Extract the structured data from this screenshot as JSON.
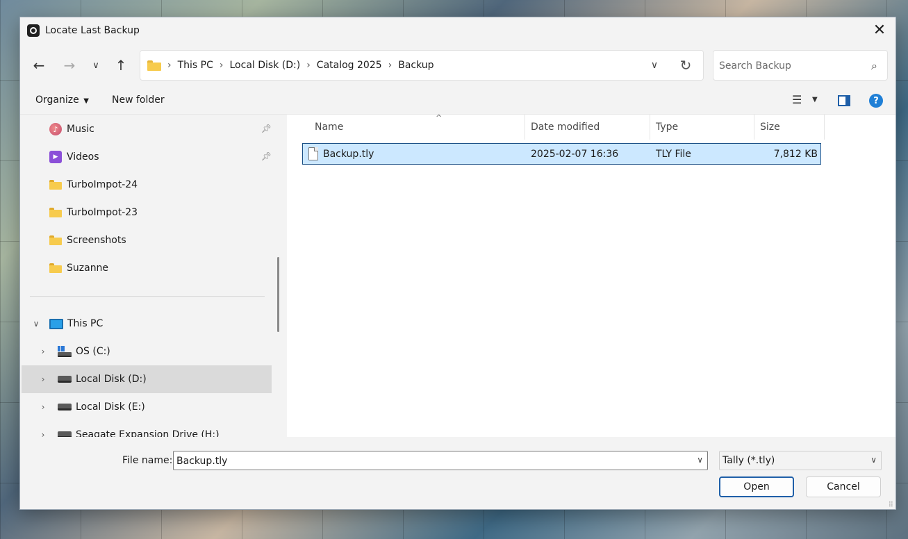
{
  "window": {
    "title": "Locate Last Backup"
  },
  "nav": {
    "back_icon": "arrow-left-icon",
    "forward_icon": "arrow-right-icon",
    "recent_icon": "chevron-down-icon",
    "up_icon": "arrow-up-icon",
    "breadcrumb": [
      "This PC",
      "Local Disk (D:)",
      "Catalog 2025",
      "Backup"
    ],
    "search_placeholder": "Search Backup"
  },
  "toolbar": {
    "organize_label": "Organize",
    "new_folder_label": "New folder"
  },
  "sidebar": {
    "quick_access": [
      {
        "label": "Music",
        "icon": "music-icon",
        "pinned": true
      },
      {
        "label": "Videos",
        "icon": "video-icon",
        "pinned": true
      },
      {
        "label": "TurboImpot-24",
        "icon": "folder-icon",
        "pinned": false
      },
      {
        "label": "TurboImpot-23",
        "icon": "folder-icon",
        "pinned": false
      },
      {
        "label": "Screenshots",
        "icon": "folder-icon",
        "pinned": false
      },
      {
        "label": "Suzanne",
        "icon": "folder-icon",
        "pinned": false
      }
    ],
    "this_pc": {
      "label": "This PC",
      "expanded": true
    },
    "drives": [
      {
        "label": "OS (C:)",
        "icon": "os-drive-icon",
        "selected": false
      },
      {
        "label": "Local Disk (D:)",
        "icon": "drive-icon",
        "selected": true
      },
      {
        "label": "Local Disk (E:)",
        "icon": "drive-icon",
        "selected": false
      },
      {
        "label": "Seagate Expansion Drive (H:)",
        "icon": "drive-icon",
        "selected": false
      }
    ]
  },
  "files": {
    "columns": [
      "Name",
      "Date modified",
      "Type",
      "Size"
    ],
    "rows": [
      {
        "name": "Backup.tly",
        "date": "2025-02-07 16:36",
        "type": "TLY File",
        "size": "7,812 KB",
        "selected": true
      }
    ]
  },
  "footer": {
    "file_name_label": "File name:",
    "file_name_value": "Backup.tly",
    "filter_value": "Tally (*.tly)",
    "open_label": "Open",
    "cancel_label": "Cancel"
  },
  "colors": {
    "selection_bg": "#cce8ff",
    "selection_border": "#1b4f86",
    "accent": "#1f5fa8"
  }
}
